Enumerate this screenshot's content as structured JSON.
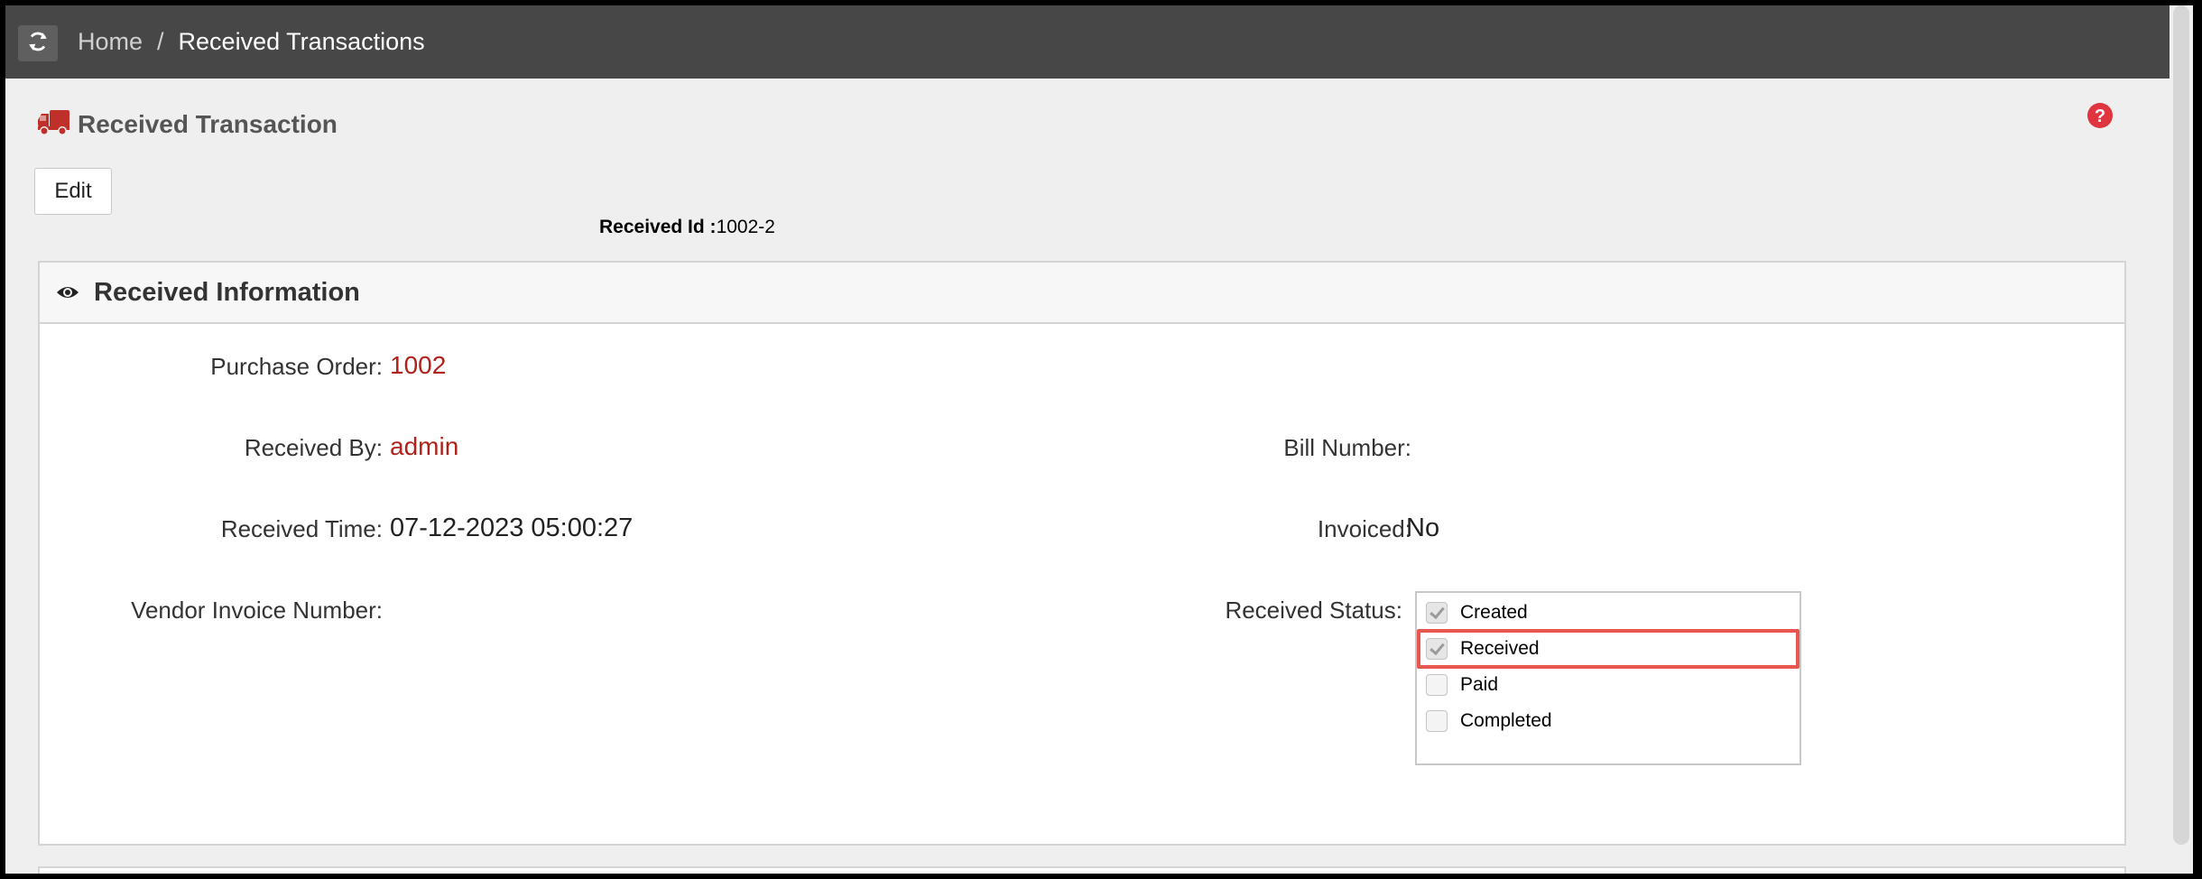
{
  "breadcrumb": {
    "home": "Home",
    "separator": "/",
    "current": "Received Transactions"
  },
  "page": {
    "title": "Received Transaction",
    "title_icon": "truck-icon",
    "help_icon": "question-circle-icon"
  },
  "toolbar": {
    "edit_label": "Edit"
  },
  "received_id": {
    "label": "Received Id :",
    "value": "1002-2"
  },
  "panel": {
    "title": "Received Information",
    "icon": "eye-icon",
    "purchase_order": {
      "label": "Purchase Order:",
      "value": "1002"
    },
    "received_by": {
      "label": "Received By:",
      "value": "admin"
    },
    "received_time": {
      "label": "Received Time:",
      "value": "07-12-2023 05:00:27"
    },
    "vendor_invoice_number": {
      "label": "Vendor Invoice Number:",
      "value": ""
    },
    "bill_number": {
      "label": "Bill Number:",
      "value": ""
    },
    "invoiced": {
      "label": "Invoiced:",
      "value": "No"
    },
    "received_status": {
      "label": "Received Status:",
      "options": [
        {
          "label": "Created",
          "checked": true
        },
        {
          "label": "Received",
          "checked": true,
          "highlighted": true
        },
        {
          "label": "Paid",
          "checked": false
        },
        {
          "label": "Completed",
          "checked": false
        }
      ]
    }
  },
  "colors": {
    "topbar": "#474747",
    "accent_red": "#b0221b",
    "highlight_border": "#e8574f",
    "help_icon": "#e0343f"
  }
}
